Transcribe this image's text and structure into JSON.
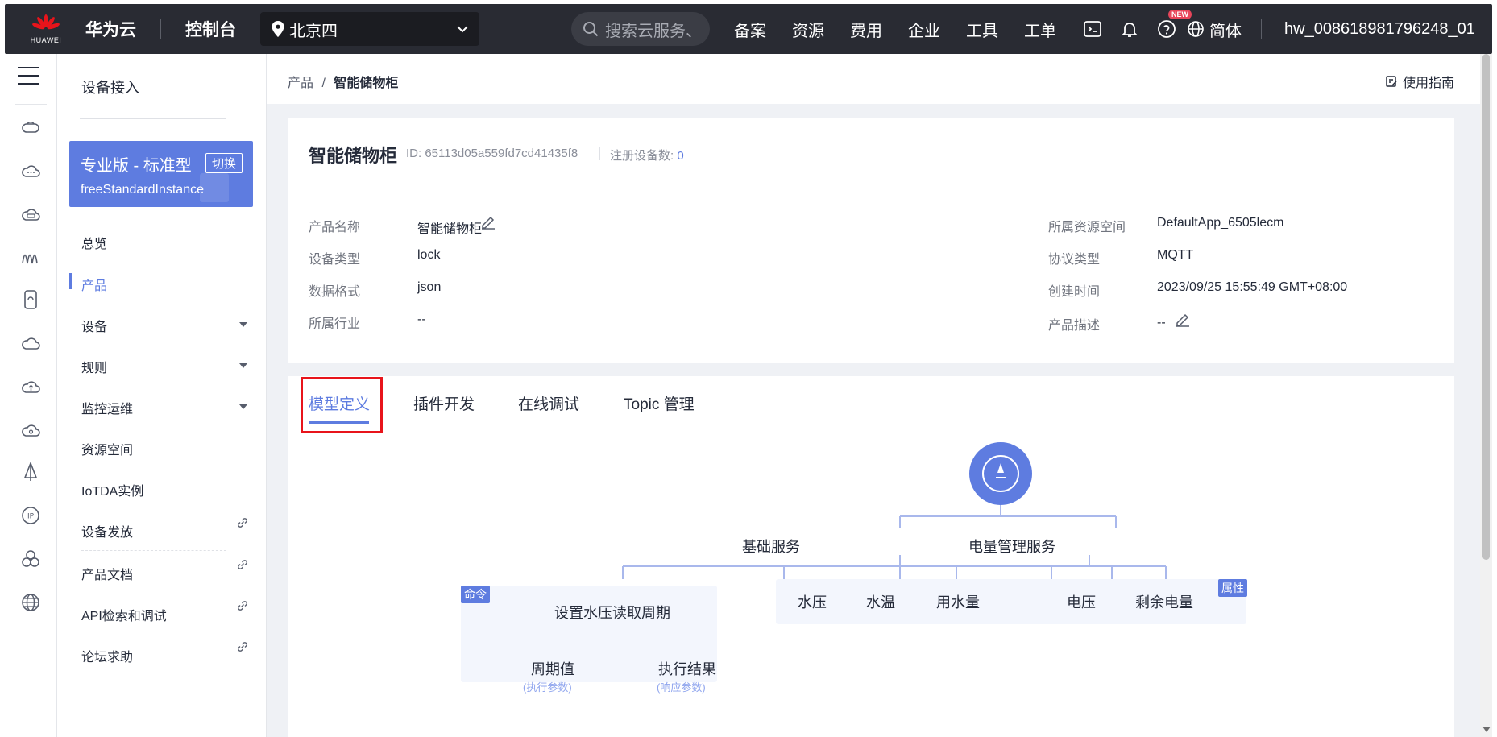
{
  "topbar": {
    "logo_caption": "HUAWEI",
    "brand": "华为云",
    "console": "控制台",
    "region": "北京四",
    "search_placeholder": "搜索云服务、",
    "nav": [
      "备案",
      "资源",
      "费用",
      "企业",
      "工具",
      "工单"
    ],
    "new_badge": "NEW",
    "language": "简体",
    "user": "hw_008618981796248_01"
  },
  "rail": {
    "icons": [
      "gateway-icon",
      "cloud-dots-icon",
      "cloud-device-icon",
      "waves-icon",
      "phone-icon",
      "cloud-icon",
      "cloud-upload-icon",
      "cloud-settings-icon",
      "sail-icon",
      "ip-icon",
      "cluster-icon",
      "globe-icon"
    ]
  },
  "sidebar": {
    "title": "设备接入",
    "instance": {
      "title": "专业版 - 标准型",
      "switch": "切换",
      "name": "freeStandardInstance"
    },
    "items": [
      "总览",
      "产品",
      "设备",
      "规则",
      "监控运维",
      "资源空间",
      "IoTDA实例",
      "设备发放",
      "产品文档",
      "API检索和调试",
      "论坛求助"
    ]
  },
  "breadcrumb": {
    "parent": "产品",
    "sep": "/",
    "current": "智能储物柜"
  },
  "guide": "使用指南",
  "product": {
    "title": "智能储物柜",
    "id": "ID: 65113d05a559fd7cd41435f8",
    "count_label": "注册设备数:",
    "count": "0",
    "left": [
      {
        "label": "产品名称",
        "value": "智能储物柜"
      },
      {
        "label": "设备类型",
        "value": "lock"
      },
      {
        "label": "数据格式",
        "value": "json"
      },
      {
        "label": "所属行业",
        "value": "--"
      }
    ],
    "right": [
      {
        "label": "所属资源空间",
        "value": "DefaultApp_6505lecm"
      },
      {
        "label": "协议类型",
        "value": "MQTT"
      },
      {
        "label": "创建时间",
        "value": "2023/09/25 15:55:49 GMT+08:00"
      },
      {
        "label": "产品描述",
        "value": "--"
      }
    ]
  },
  "tabs": [
    "模型定义",
    "插件开发",
    "在线调试",
    "Topic 管理"
  ],
  "model": {
    "services": [
      "基础服务",
      "电量管理服务"
    ],
    "command_tag": "命令",
    "property_tag": "属性",
    "command": "设置水压读取周期",
    "command_params": [
      "周期值",
      "执行结果"
    ],
    "command_param_subs": [
      "(执行参数)",
      "(响应参数)"
    ],
    "basic_properties": [
      "水压",
      "水温",
      "用水量"
    ],
    "power_properties": [
      "电压",
      "剩余电量"
    ]
  },
  "colors": {
    "accent": "#5e7ce0",
    "topbar": "#292b33",
    "highlight": "#e8141b"
  }
}
